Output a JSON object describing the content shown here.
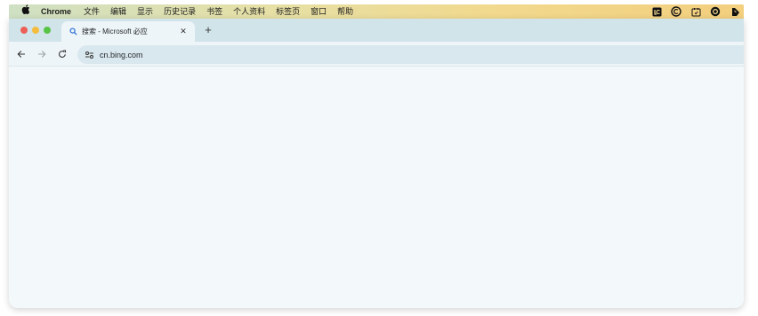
{
  "menubar": {
    "apple_icon": "apple-logo-icon",
    "app_name": "Chrome",
    "items": [
      "文件",
      "编辑",
      "显示",
      "历史记录",
      "书签",
      "个人资料",
      "标签页",
      "窗口",
      "帮助"
    ],
    "status_icons": [
      "lc-icon",
      "c-badge-icon",
      "calendar-icon",
      "record-icon",
      "kite-icon"
    ],
    "colors": {
      "gradient_start": "#cfe0c3",
      "gradient_end": "#f3cf7e"
    }
  },
  "window": {
    "traffic_lights": {
      "close": "#ec5f57",
      "minimize": "#f4bd3d",
      "zoom": "#58c443"
    },
    "tab": {
      "title": "搜索 - Microsoft 必应",
      "icon": "search-icon",
      "close_glyph": "✕"
    },
    "new_tab_glyph": "+",
    "toolbar": {
      "back_icon": "arrow-left-icon",
      "forward_icon": "arrow-right-icon",
      "reload_icon": "reload-icon",
      "site_info_icon": "tune-icon",
      "url": "cn.bing.com"
    },
    "colors": {
      "tabstrip": "#d1e4ea",
      "toolbar": "#eef5f8",
      "omnibox": "#d9e8ee",
      "content": "#f3f8fb"
    }
  }
}
